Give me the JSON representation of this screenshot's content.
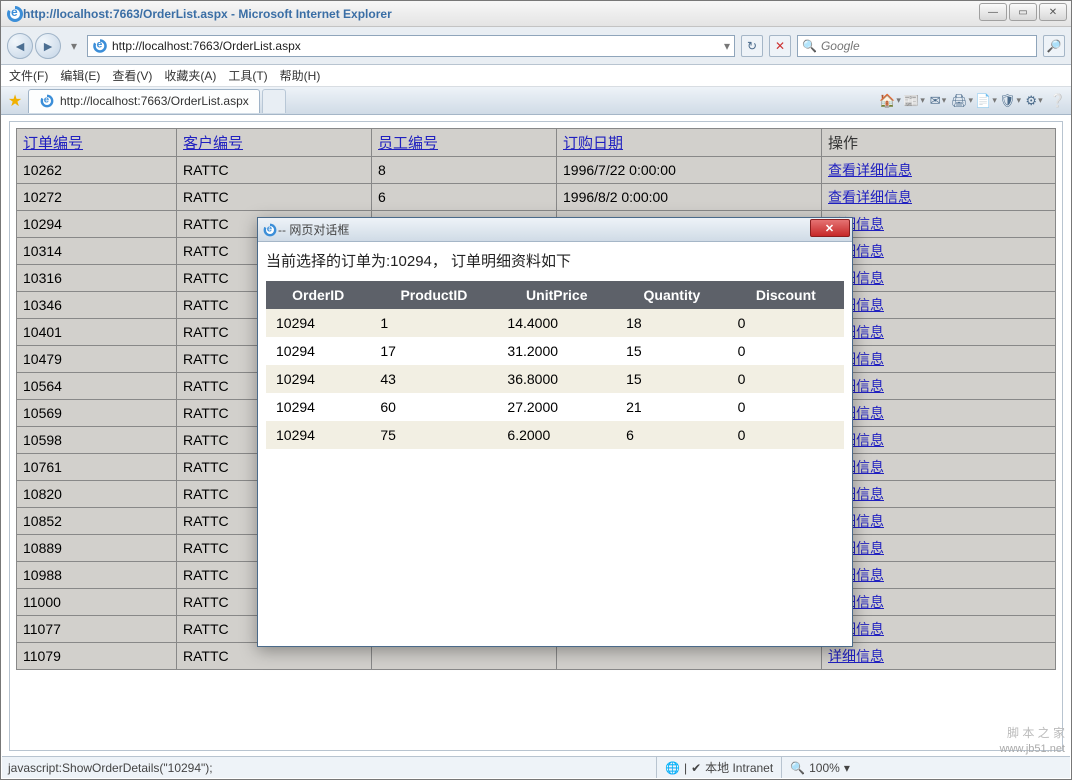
{
  "window": {
    "title": "http://localhost:7663/OrderList.aspx - Microsoft Internet Explorer",
    "address": "http://localhost:7663/OrderList.aspx",
    "search_placeholder": "Google",
    "tab_label": "http://localhost:7663/OrderList.aspx",
    "win_buttons": {
      "min": "—",
      "max": "▭",
      "close": "✕"
    }
  },
  "menu": {
    "file": "文件(F)",
    "edit": "编辑(E)",
    "view": "查看(V)",
    "favorites": "收藏夹(A)",
    "tools": "工具(T)",
    "help": "帮助(H)"
  },
  "headers": {
    "order_id": "订单编号",
    "customer_id": "客户编号",
    "employee_id": "员工编号",
    "order_date": "订购日期",
    "operate": "操作"
  },
  "action_label": "查看详细信息",
  "action_label_truncated": "详细信息",
  "orders": [
    {
      "oid": "10262",
      "cust": "RATTC",
      "emp": "8",
      "date": "1996/7/22 0:00:00"
    },
    {
      "oid": "10272",
      "cust": "RATTC",
      "emp": "6",
      "date": "1996/8/2 0:00:00"
    },
    {
      "oid": "10294",
      "cust": "RATTC",
      "emp": "",
      "date": ""
    },
    {
      "oid": "10314",
      "cust": "RATTC",
      "emp": "",
      "date": ""
    },
    {
      "oid": "10316",
      "cust": "RATTC",
      "emp": "",
      "date": ""
    },
    {
      "oid": "10346",
      "cust": "RATTC",
      "emp": "",
      "date": ""
    },
    {
      "oid": "10401",
      "cust": "RATTC",
      "emp": "",
      "date": ""
    },
    {
      "oid": "10479",
      "cust": "RATTC",
      "emp": "",
      "date": ""
    },
    {
      "oid": "10564",
      "cust": "RATTC",
      "emp": "",
      "date": ""
    },
    {
      "oid": "10569",
      "cust": "RATTC",
      "emp": "",
      "date": ""
    },
    {
      "oid": "10598",
      "cust": "RATTC",
      "emp": "",
      "date": ""
    },
    {
      "oid": "10761",
      "cust": "RATTC",
      "emp": "",
      "date": ""
    },
    {
      "oid": "10820",
      "cust": "RATTC",
      "emp": "",
      "date": ""
    },
    {
      "oid": "10852",
      "cust": "RATTC",
      "emp": "",
      "date": ""
    },
    {
      "oid": "10889",
      "cust": "RATTC",
      "emp": "",
      "date": ""
    },
    {
      "oid": "10988",
      "cust": "RATTC",
      "emp": "",
      "date": ""
    },
    {
      "oid": "11000",
      "cust": "RATTC",
      "emp": "",
      "date": ""
    },
    {
      "oid": "11077",
      "cust": "RATTC",
      "emp": "",
      "date": ""
    },
    {
      "oid": "11079",
      "cust": "RATTC",
      "emp": "",
      "date": ""
    }
  ],
  "dialog": {
    "title": " -- 网页对话框",
    "message": "当前选择的订单为:10294， 订单明细资料如下",
    "headers": {
      "OrderID": "OrderID",
      "ProductID": "ProductID",
      "UnitPrice": "UnitPrice",
      "Quantity": "Quantity",
      "Discount": "Discount"
    },
    "rows": [
      {
        "OrderID": "10294",
        "ProductID": "1",
        "UnitPrice": "14.4000",
        "Quantity": "18",
        "Discount": "0"
      },
      {
        "OrderID": "10294",
        "ProductID": "17",
        "UnitPrice": "31.2000",
        "Quantity": "15",
        "Discount": "0"
      },
      {
        "OrderID": "10294",
        "ProductID": "43",
        "UnitPrice": "36.8000",
        "Quantity": "15",
        "Discount": "0"
      },
      {
        "OrderID": "10294",
        "ProductID": "60",
        "UnitPrice": "27.2000",
        "Quantity": "21",
        "Discount": "0"
      },
      {
        "OrderID": "10294",
        "ProductID": "75",
        "UnitPrice": "6.2000",
        "Quantity": "6",
        "Discount": "0"
      }
    ]
  },
  "status": {
    "left": "javascript:ShowOrderDetails(\"10294\");",
    "zone": "本地 Intranet",
    "zoom": "100%"
  },
  "watermark": {
    "title": "脚 本 之 家",
    "url": "www.jb51.net"
  }
}
